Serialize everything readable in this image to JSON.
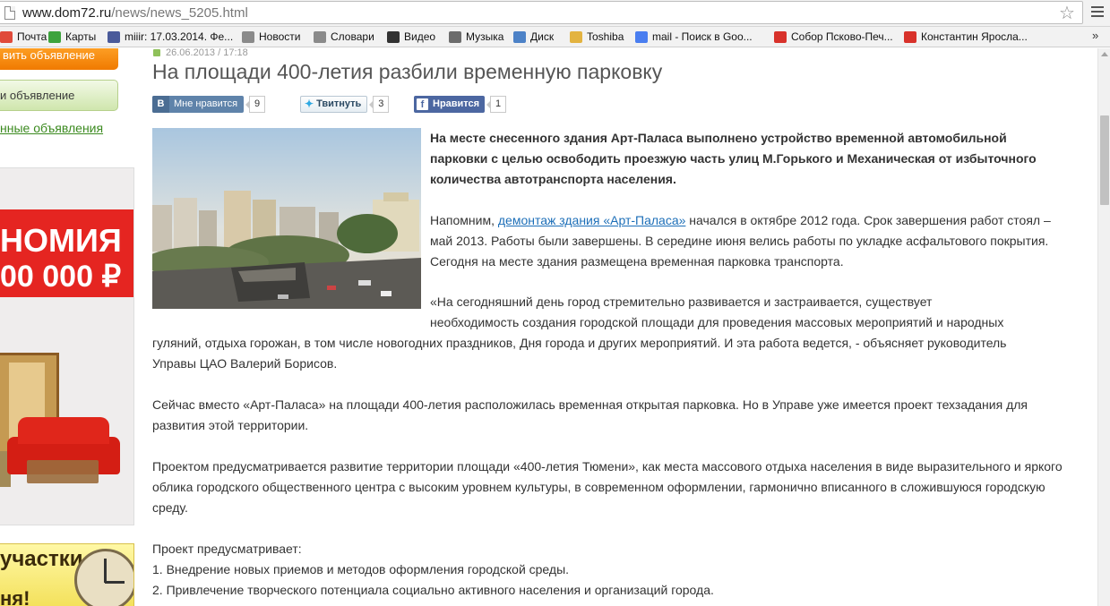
{
  "browser": {
    "url_host": "www.dom72.ru",
    "url_path": "/news/news_5205.html",
    "bookmarks": [
      {
        "label": "Почта",
        "icon": "mail-icon",
        "color": "#e04a3a"
      },
      {
        "label": "Карты",
        "icon": "maps-icon",
        "color": "#3da33d"
      },
      {
        "label": "miiir: 17.03.2014. Фе...",
        "icon": "user-icon",
        "color": "#4a5a9a"
      },
      {
        "label": "Новости",
        "icon": "page-icon",
        "color": "#8a8a8a"
      },
      {
        "label": "Словари",
        "icon": "page-icon",
        "color": "#8a8a8a"
      },
      {
        "label": "Видео",
        "icon": "video-icon",
        "color": "#333333"
      },
      {
        "label": "Музыка",
        "icon": "music-icon",
        "color": "#6c6c6c"
      },
      {
        "label": "Диск",
        "icon": "disk-icon",
        "color": "#4d82c7"
      },
      {
        "label": "Toshiba",
        "icon": "folder-icon",
        "color": "#e3b340"
      },
      {
        "label": "mail - Поиск в Goo...",
        "icon": "google-icon",
        "color": "#4a7ef0"
      },
      {
        "label": "Собор Псково-Печ...",
        "icon": "yandex-icon",
        "color": "#d8322b"
      },
      {
        "label": "Константин Яросла...",
        "icon": "yandex-icon",
        "color": "#d8322b"
      }
    ],
    "more": "»"
  },
  "sidebar": {
    "post_ad_button": "вить объявление",
    "my_ads_button": "и объявление",
    "saved_ads_link": "нные объявления",
    "ad1": {
      "line1": "НОМИЯ",
      "line2": "00 000 ₽"
    },
    "ad2": {
      "line1": "участки",
      "line2": "ня!"
    }
  },
  "article": {
    "date": "26.06.2013 / 17:18",
    "title": "На площади 400-летия разбили временную парковку",
    "share": {
      "vk_label": "Мне нравится",
      "vk_count": "9",
      "tw_label": "Твитнуть",
      "tw_count": "3",
      "fb_label": "Нравится",
      "fb_count": "1"
    },
    "lead": "На месте снесенного здания Арт-Паласа выполнено устройство временной автомобильной парковки с целью освободить проезжую часть улиц М.Горького и Механическая от избыточного количества автотранспорта населения.",
    "p1_before": "Напомним, ",
    "p1_link": "демонтаж здания «Арт-Паласа»",
    "p1_after": " начался в октябре 2012 года. Срок завершения работ стоял – май 2013. Работы были завершены. В середине июня велись работы по укладке асфальтового покрытия. Сегодня на месте здания размещена временная парковка транспорта.",
    "p2_a": "«На сегодняшний день город  стремительно развивается и застраивается, существует",
    "p2_b": "необходимость создания городской площади для проведения массовых мероприятий и народных",
    "p2_c": "гуляний, отдыха горожан, в том числе новогодних праздников, Дня города и других мероприятий. И эта работа ведется, - объясняет руководитель Управы ЦАО Валерий Борисов.",
    "p3": "Сейчас вместо «Арт-Паласа» на площади 400-летия расположилась временная открытая парковка. Но в Управе уже имеется проект техзадания для развития этой территории.",
    "p4": "Проектом предусматривается развитие  территории  площади «400-летия Тюмени», как места массового отдыха населения в виде  выразительного  и  яркого  облика  городского общественного центра  с высоким уровнем культуры,  в современном  оформлении, гармонично вписанного  в сложившуюся городскую среду.",
    "p5_head": "Проект предусматривает:",
    "p5_1": "1. Внедрение  новых   приемов и методов оформления  городской среды.",
    "p5_2": "2. Привлечение творческого  потенциала социально активного населения и организаций города."
  }
}
